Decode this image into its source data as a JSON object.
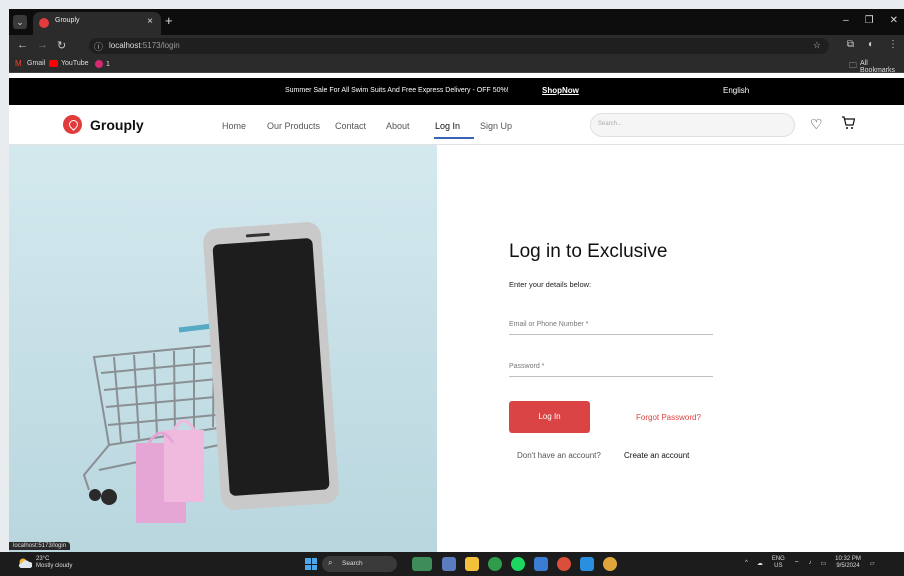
{
  "browser": {
    "tab_title": "Grouply",
    "url_host": "localhost",
    "url_path": ":5173/login",
    "bookmarks": [
      "Gmail",
      "YouTube",
      "1"
    ],
    "all_bookmarks": "All Bookmarks",
    "status_url": "localhost:5173/login"
  },
  "announcement": {
    "text": "Summer Sale For All Swim Suits And Free Express Delivery - OFF 50%!",
    "link": "ShopNow",
    "language": "English"
  },
  "header": {
    "brand": "Grouply",
    "nav": [
      "Home",
      "Our Products",
      "Contact",
      "About",
      "Log In",
      "Sign Up"
    ],
    "active_nav": "Log In",
    "search_placeholder": "Search...",
    "icons": [
      "heart-icon",
      "cart-icon"
    ]
  },
  "login": {
    "title": "Log in to Exclusive",
    "subtitle": "Enter your details below:",
    "email_label": "Email or Phone Number *",
    "password_label": "Password *",
    "submit": "Log In",
    "forgot": "Forgot Password?",
    "no_account": "Don't have an account?",
    "create": "Create an account"
  },
  "taskbar": {
    "temp": "23°C",
    "weather": "Mostly cloudy",
    "search": "Search",
    "lang_top": "ENG",
    "lang_bottom": "US",
    "time": "10:32 PM",
    "date": "9/5/2024"
  },
  "colors": {
    "accent": "#db4444",
    "brand": "#e23b3b",
    "hero_bg": "#cfe6ec",
    "nav_underline": "#3b63b5"
  }
}
